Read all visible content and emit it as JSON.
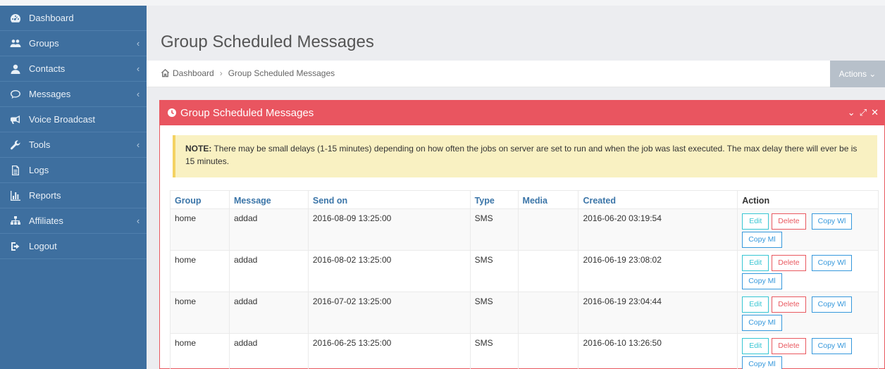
{
  "sidebar": {
    "items": [
      {
        "label": "Dashboard",
        "icon": "dashboard-icon",
        "has_chevron": false
      },
      {
        "label": "Groups",
        "icon": "users-icon",
        "has_chevron": true
      },
      {
        "label": "Contacts",
        "icon": "user-icon",
        "has_chevron": true
      },
      {
        "label": "Messages",
        "icon": "comment-icon",
        "has_chevron": true
      },
      {
        "label": "Voice Broadcast",
        "icon": "bullhorn-icon",
        "has_chevron": false
      },
      {
        "label": "Tools",
        "icon": "wrench-icon",
        "has_chevron": true
      },
      {
        "label": "Logs",
        "icon": "file-icon",
        "has_chevron": false
      },
      {
        "label": "Reports",
        "icon": "bar-chart-icon",
        "has_chevron": false
      },
      {
        "label": "Affiliates",
        "icon": "sitemap-icon",
        "has_chevron": true
      },
      {
        "label": "Logout",
        "icon": "logout-icon",
        "has_chevron": false
      }
    ],
    "chevron": "‹"
  },
  "page": {
    "title": "Group Scheduled Messages"
  },
  "breadcrumb": {
    "home": "Dashboard",
    "separator": "›",
    "current": "Group Scheduled Messages"
  },
  "actions": {
    "label": "Actions ⌄"
  },
  "portlet": {
    "title": "Group Scheduled Messages",
    "tools": {
      "collapse": "⌄",
      "fullscreen": "⤢",
      "close": "✕"
    }
  },
  "note": {
    "label": "NOTE:",
    "text": " There may be small delays (1-15 minutes) depending on how often the jobs on server are set to run and when the job was last executed. The max delay there will ever be is 15 minutes."
  },
  "table": {
    "headers": {
      "group": "Group",
      "message": "Message",
      "send_on": "Send on",
      "type": "Type",
      "media": "Media",
      "created": "Created",
      "action": "Action"
    },
    "buttons": {
      "edit": "Edit",
      "delete": "Delete",
      "copy_wl": "Copy Wl",
      "copy_ml": "Copy Ml"
    },
    "rows": [
      {
        "group": "home",
        "message": "addad",
        "send_on": "2016-08-09 13:25:00",
        "type": "SMS",
        "media": "",
        "created": "2016-06-20 03:19:54"
      },
      {
        "group": "home",
        "message": "addad",
        "send_on": "2016-08-02 13:25:00",
        "type": "SMS",
        "media": "",
        "created": "2016-06-19 23:08:02"
      },
      {
        "group": "home",
        "message": "addad",
        "send_on": "2016-07-02 13:25:00",
        "type": "SMS",
        "media": "",
        "created": "2016-06-19 23:04:44"
      },
      {
        "group": "home",
        "message": "addad",
        "send_on": "2016-06-25 13:25:00",
        "type": "SMS",
        "media": "",
        "created": "2016-06-10 13:26:50"
      }
    ]
  },
  "colors": {
    "sidebar_bg": "#3e6f9f",
    "portlet_header": "#e95560",
    "note_bg": "#f9f1c2",
    "edit_btn": "#36c6d3",
    "delete_btn": "#e9585f",
    "copy_btn": "#3598dc"
  }
}
